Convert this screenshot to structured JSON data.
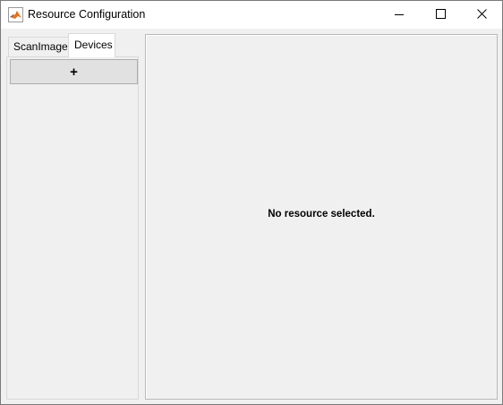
{
  "window": {
    "title": "Resource Configuration",
    "app_icon": "matlab-icon",
    "controls": {
      "minimize_icon": "minimize-icon",
      "maximize_icon": "maximize-icon",
      "close_icon": "close-icon"
    }
  },
  "sidebar": {
    "tabs": [
      {
        "label": "ScanImage",
        "selected": false
      },
      {
        "label": "Devices",
        "selected": true
      }
    ],
    "add_button_label": "+"
  },
  "main": {
    "empty_message": "No resource selected."
  },
  "colors": {
    "window_bg": "#f0f0f0",
    "titlebar_bg": "#ffffff",
    "button_bg": "#e1e1e1",
    "border": "#adadad"
  }
}
